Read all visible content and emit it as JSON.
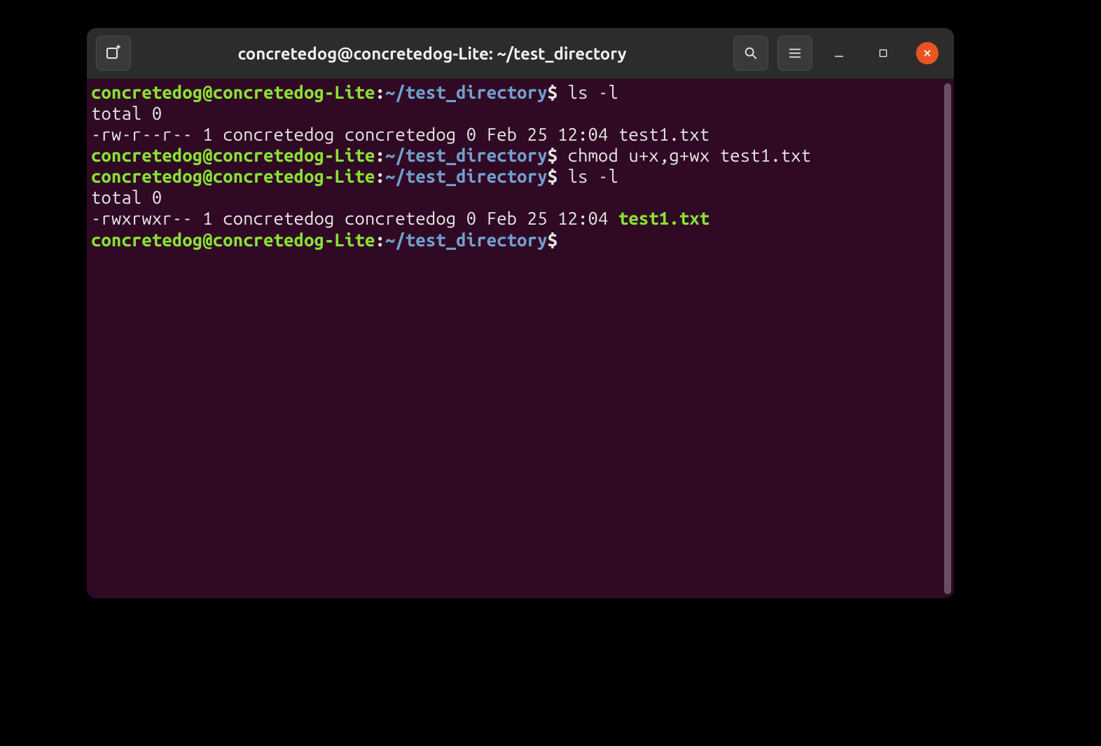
{
  "window": {
    "title": "concretedog@concretedog-Lite: ~/test_directory"
  },
  "prompt": {
    "user_host": "concretedog@concretedog-Lite",
    "sep": ":",
    "cwd": "~/test_directory",
    "sigil": "$"
  },
  "colors": {
    "background": "#300a24",
    "titlebar": "#2c2c2c",
    "accent_close": "#e95420",
    "prompt_user": "#8ae234",
    "prompt_path": "#729fcf",
    "text": "#e6e6e6"
  },
  "session": [
    {
      "kind": "prompt",
      "command": "ls -l"
    },
    {
      "kind": "output",
      "text": "total 0"
    },
    {
      "kind": "output",
      "text": "-rw-r--r-- 1 concretedog concretedog 0 Feb 25 12:04 test1.txt"
    },
    {
      "kind": "prompt",
      "command": "chmod u+x,g+wx test1.txt"
    },
    {
      "kind": "prompt",
      "command": "ls -l"
    },
    {
      "kind": "output",
      "text": "total 0"
    },
    {
      "kind": "output-exec",
      "pre": "-rwxrwxr-- 1 concretedog concretedog 0 Feb 25 12:04 ",
      "file": "test1.txt"
    },
    {
      "kind": "prompt",
      "command": ""
    }
  ]
}
